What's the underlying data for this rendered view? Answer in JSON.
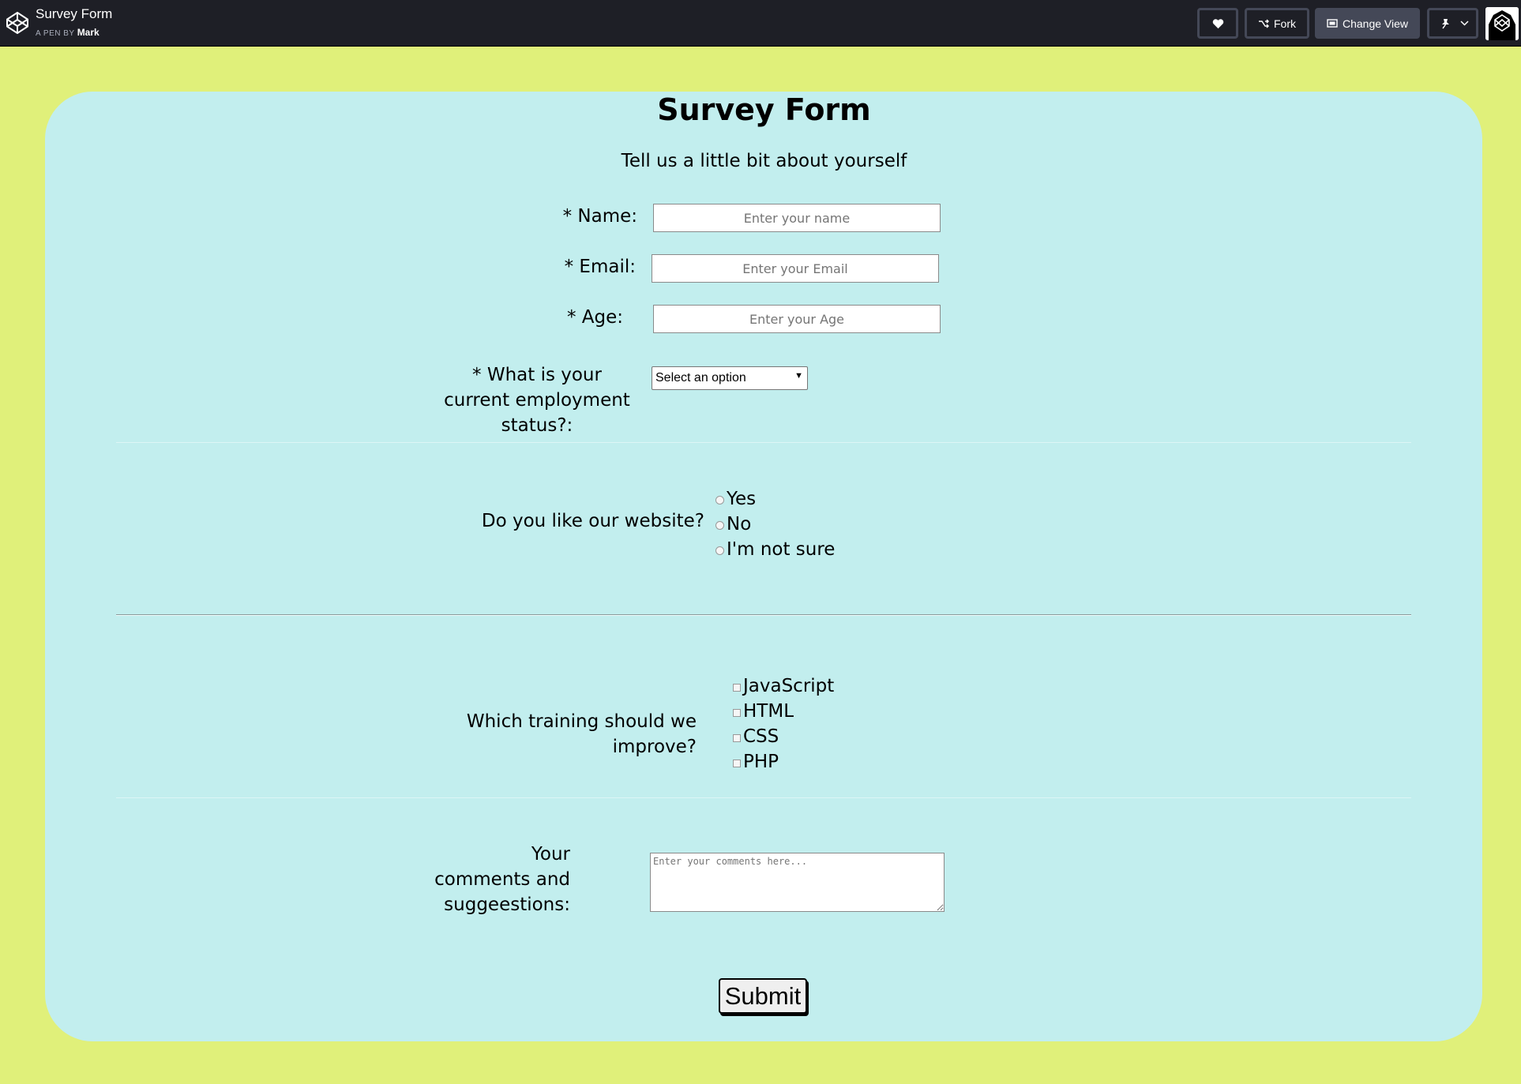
{
  "topbar": {
    "pen_title": "Survey Form",
    "pen_by": "A PEN BY",
    "author": "Mark",
    "fork_label": "Fork",
    "change_view_label": "Change View",
    "icons": [
      "codepen-logo-icon",
      "heart-icon",
      "fork-icon",
      "change-view-icon",
      "pin-icon",
      "chevron-down-icon"
    ]
  },
  "form": {
    "title": "Survey Form",
    "description": "Tell us a little bit about yourself",
    "name_label": "* Name:",
    "name_placeholder": "Enter your name",
    "email_label": "* Email:",
    "email_placeholder": "Enter your Email",
    "age_label": "* Age:",
    "age_placeholder": "Enter your Age",
    "employment_label_lines": [
      "* What is your",
      "current employment",
      "status?:"
    ],
    "employment_selected": "Select an option",
    "website_question": "Do you like our website?",
    "website_options": [
      "Yes",
      "No",
      "I'm not sure"
    ],
    "training_question": "Which training should we improve?",
    "training_options": [
      "JavaScript",
      "HTML",
      "CSS",
      "PHP"
    ],
    "comments_label_lines": [
      "Your",
      "comments and",
      "suggeestions:"
    ],
    "comments_placeholder": "Enter your comments here...",
    "submit_label": "Submit"
  },
  "colors": {
    "page_background": "#e0f07a",
    "card_background": "#c2eeee",
    "topbar_background": "#1e1f26"
  }
}
